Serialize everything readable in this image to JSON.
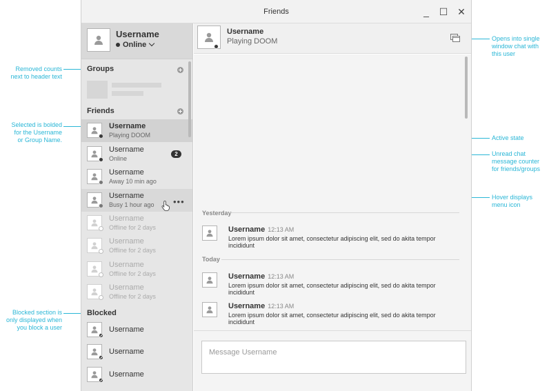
{
  "window": {
    "title": "Friends"
  },
  "window_controls": {
    "minimize": "_",
    "maximize": "☐",
    "close": "✕"
  },
  "me": {
    "username": "Username",
    "status": "Online"
  },
  "groups": {
    "label": "Groups"
  },
  "friends": {
    "label": "Friends",
    "items": [
      {
        "name": "Username",
        "sub": "Playing DOOM",
        "state": "active",
        "presence": "online"
      },
      {
        "name": "Username",
        "sub": "Online",
        "state": "unread",
        "presence": "online",
        "badge": "2"
      },
      {
        "name": "Username",
        "sub": "Away 10 min ago",
        "state": "normal",
        "presence": "away"
      },
      {
        "name": "Username",
        "sub": "Busy 1 hour ago",
        "state": "hover",
        "presence": "busy"
      },
      {
        "name": "Username",
        "sub": "Offline for 2 days",
        "state": "offline",
        "presence": "offline"
      },
      {
        "name": "Username",
        "sub": "Offline for 2 days",
        "state": "offline",
        "presence": "offline"
      },
      {
        "name": "Username",
        "sub": "Offline for 2 days",
        "state": "offline",
        "presence": "offline"
      },
      {
        "name": "Username",
        "sub": "Offline for 2 days",
        "state": "offline",
        "presence": "offline"
      }
    ]
  },
  "blocked": {
    "label": "Blocked",
    "items": [
      {
        "name": "Username"
      },
      {
        "name": "Username"
      },
      {
        "name": "Username"
      }
    ]
  },
  "chat": {
    "header": {
      "username": "Username",
      "status": "Playing DOOM"
    },
    "days": [
      "Yesterday",
      "Today"
    ],
    "messages": [
      {
        "name": "Username",
        "time": "12:13 AM",
        "text": "Lorem ipsum dolor sit amet, consectetur adipiscing elit, sed do akita tempor incididunt"
      },
      {
        "name": "Username",
        "time": "12:13 AM",
        "text": "Lorem ipsum dolor sit amet, consectetur adipiscing elit, sed do akita tempor incididunt"
      },
      {
        "name": "Username",
        "time": "12:13 AM",
        "text": "Lorem ipsum dolor sit amet, consectetur adipiscing elit, sed do akita tempor incididunt"
      }
    ],
    "composer_placeholder": "Message Username"
  },
  "annotations": {
    "removed_counts": "Removed counts\nnext to header text",
    "selected_bolded": "Selected is bolded\nfor the Username\nor Group Name.",
    "blocked_section": "Blocked section is\nonly displayed when\nyou block a user",
    "opens_single": "Opens into single\nwindow chat with\nthis user",
    "active_state": "Active state",
    "unread_counter": "Unread chat\nmessage counter\nfor friends/groups",
    "hover_menu": "Hover displays\nmenu icon"
  },
  "colors": {
    "annotation": "#29b6d6",
    "sidebar": "#e6e6e6",
    "active_row": "#d2d2d2",
    "dark": "#333333"
  }
}
